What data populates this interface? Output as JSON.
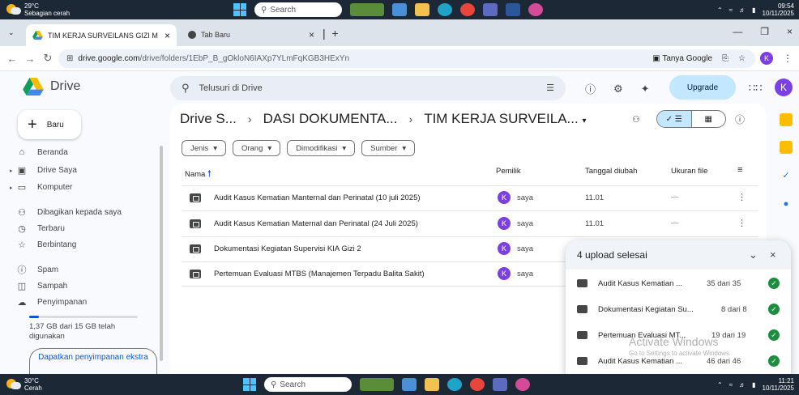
{
  "taskbar_top": {
    "weather_temp": "29°C",
    "weather_desc": "Sebagian cerah",
    "search": "Search",
    "time": "09:54",
    "date": "10/11/2025"
  },
  "taskbar_bottom": {
    "weather_temp": "30°C",
    "weather_desc": "Cerah",
    "search": "Search",
    "time": "11:21",
    "date": "10/11/2025"
  },
  "browser": {
    "tab_active": "TIM KERJA SURVEILANS GIZI M",
    "tab_inactive": "Tab Baru",
    "url_host": "drive.google.com",
    "url_path": "/drive/folders/1EbP_B_gOkloN6IAXp7YLmFqKGB3HExYn",
    "ask_google": "Tanya Google",
    "profile_initial": "K"
  },
  "drive": {
    "logo": "Drive",
    "search_placeholder": "Telusuri di Drive",
    "upgrade": "Upgrade",
    "account_initial": "K",
    "new_button": "Baru",
    "sidebar": [
      {
        "label": "Beranda",
        "icon": "home-icon"
      },
      {
        "label": "Drive Saya",
        "icon": "my-drive-icon"
      },
      {
        "label": "Komputer",
        "icon": "computer-icon"
      },
      {
        "label": "Dibagikan kepada saya",
        "icon": "shared-icon"
      },
      {
        "label": "Terbaru",
        "icon": "clock-icon"
      },
      {
        "label": "Berbintang",
        "icon": "star-icon"
      },
      {
        "label": "Spam",
        "icon": "spam-icon"
      },
      {
        "label": "Sampah",
        "icon": "trash-icon"
      },
      {
        "label": "Penyimpanan",
        "icon": "cloud-icon"
      }
    ],
    "storage_used_fraction": 0.09,
    "storage_text": "1,37 GB dari 15 GB telah digunakan",
    "get_storage": "Dapatkan penyimpanan ekstra",
    "breadcrumb": [
      "Drive S...",
      "DASI DOKUMENTA...",
      "TIM KERJA SURVEILA..."
    ],
    "filters": [
      "Jenis",
      "Orang",
      "Dimodifikasi",
      "Sumber"
    ],
    "columns": {
      "name": "Nama",
      "owner": "Pemilik",
      "modified": "Tanggal diubah",
      "size": "Ukuran file"
    },
    "files": [
      {
        "name": "Audit Kasus Kematian Manternal dan Perinatal (10 juli 2025)",
        "owner": "saya",
        "owner_initial": "K",
        "modified": "11.01",
        "size": "—"
      },
      {
        "name": "Audit Kasus Kematian Maternal dan Perinatal (24 Juli 2025)",
        "owner": "saya",
        "owner_initial": "K",
        "modified": "11.01",
        "size": "—"
      },
      {
        "name": "Dokumentasi Kegiatan Supervisi KIA Gizi 2",
        "owner": "saya",
        "owner_initial": "K",
        "modified": "",
        "size": ""
      },
      {
        "name": "Pertemuan Evaluasi MTBS (Manajemen Terpadu Balita Sakit)",
        "owner": "saya",
        "owner_initial": "K",
        "modified": "",
        "size": ""
      }
    ],
    "upload": {
      "title": "4 upload selesai",
      "items": [
        {
          "name": "Audit Kasus Kematian ...",
          "count": "35 dari 35"
        },
        {
          "name": "Dokumentasi Kegiatan Su...",
          "count": "8 dari 8"
        },
        {
          "name": "Pertemuan Evaluasi MT...",
          "count": "19 dari 19"
        },
        {
          "name": "Audit Kasus Kematian ...",
          "count": "46 dari 46"
        }
      ]
    }
  },
  "watermark": {
    "line1": "Activate Windows",
    "line2": "Go to Settings to activate Windows."
  },
  "colors": {
    "accent": "#0b57d0",
    "upgrade_bg": "#c2e7ff",
    "avatar": "#7b3fe4",
    "success": "#1e8e3e"
  }
}
